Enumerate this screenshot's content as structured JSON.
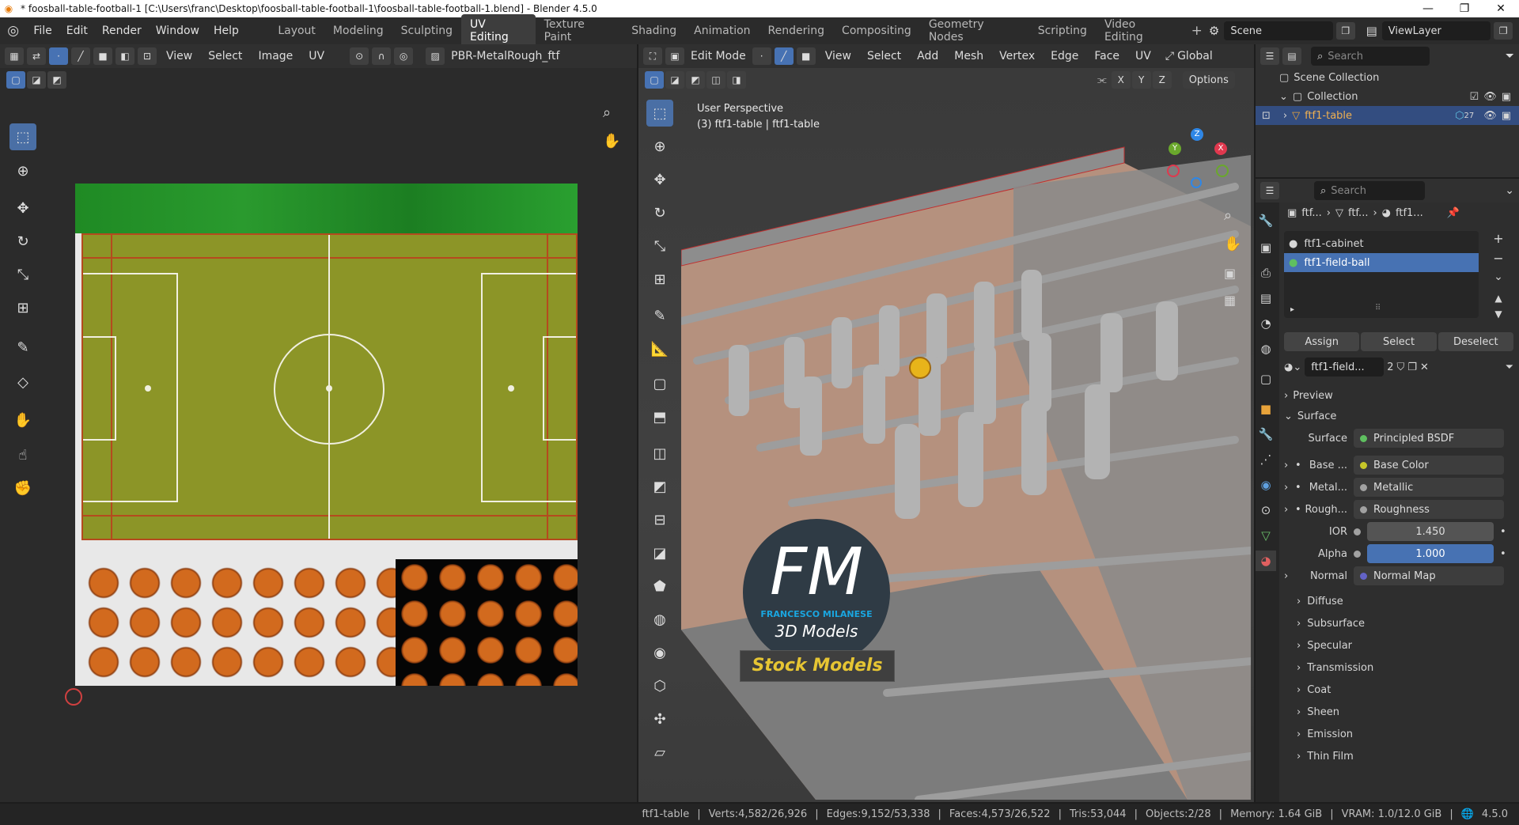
{
  "window": {
    "title": "* foosball-table-football-1 [C:\\Users\\franc\\Desktop\\foosball-table-football-1\\foosball-table-football-1.blend] - Blender 4.5.0",
    "minimize": "—",
    "maximize": "❐",
    "close": "✕"
  },
  "menu": [
    "File",
    "Edit",
    "Render",
    "Window",
    "Help"
  ],
  "workspaces": [
    "Layout",
    "Modeling",
    "Sculpting",
    "UV Editing",
    "Texture Paint",
    "Shading",
    "Animation",
    "Rendering",
    "Compositing",
    "Geometry Nodes",
    "Scripting",
    "Video Editing"
  ],
  "active_workspace": "UV Editing",
  "scene": "Scene",
  "view_layer": "ViewLayer",
  "uv_editor": {
    "menus": [
      "View",
      "Select",
      "Image",
      "UV"
    ],
    "image_name": "PBR-MetalRough_ftf"
  },
  "viewport": {
    "mode": "Edit Mode",
    "menus": [
      "View",
      "Select",
      "Add",
      "Mesh",
      "Vertex",
      "Edge",
      "Face",
      "UV"
    ],
    "orientation": "Global",
    "options_label": "Options",
    "overlay_line1": "User Perspective",
    "overlay_line2": "(3) ftf1-table | ftf1-table",
    "axis_x": "X",
    "axis_y": "Y",
    "axis_z": "Z",
    "watermark_initials": "FM",
    "watermark_name": "FRANCESCO MILANESE",
    "watermark_sub": "3D Models",
    "watermark_banner": "Stock Models"
  },
  "outliner": {
    "search_placeholder": "Search",
    "scene_collection": "Scene Collection",
    "collection": "Collection",
    "object": "ftf1-table",
    "modifier_count": "27"
  },
  "properties": {
    "search_placeholder": "Search",
    "breadcrumb": [
      "ftf...",
      "ftf...",
      "ftf1..."
    ],
    "material_slots": [
      "ftf1-cabinet",
      "ftf1-field-ball"
    ],
    "buttons": {
      "assign": "Assign",
      "select": "Select",
      "deselect": "Deselect"
    },
    "material_name": "ftf1-field...",
    "material_users": "2",
    "panels": {
      "preview": "Preview",
      "surface": "Surface"
    },
    "surface_label": "Surface",
    "surface_value": "Principled BSDF",
    "inputs": [
      {
        "label": "Base ...",
        "value": "Base Color",
        "color": "#c7c729"
      },
      {
        "label": "Metal...",
        "value": "Metallic",
        "color": "#a1a1a1"
      },
      {
        "label": "Rough...",
        "value": "Roughness",
        "color": "#a1a1a1"
      },
      {
        "label": "IOR",
        "value": "1.450",
        "color": "#a1a1a1"
      },
      {
        "label": "Alpha",
        "value": "1.000",
        "color": "#a1a1a1"
      },
      {
        "label": "Normal",
        "value": "Normal Map",
        "color": "#6363c7"
      }
    ],
    "subpanels": [
      "Diffuse",
      "Subsurface",
      "Specular",
      "Transmission",
      "Coat",
      "Sheen",
      "Emission",
      "Thin Film"
    ]
  },
  "status": {
    "object": "ftf1-table",
    "verts": "Verts:4,582/26,926",
    "edges": "Edges:9,152/53,338",
    "faces": "Faces:4,573/26,522",
    "tris": "Tris:53,044",
    "objects": "Objects:2/28",
    "memory": "Memory: 1.64 GiB",
    "vram": "VRAM: 1.0/12.0 GiB",
    "version": "4.5.0"
  },
  "colors": {
    "accent": "#4772b3",
    "brand": "#e87d0d",
    "field_green": "#8a9a28"
  }
}
